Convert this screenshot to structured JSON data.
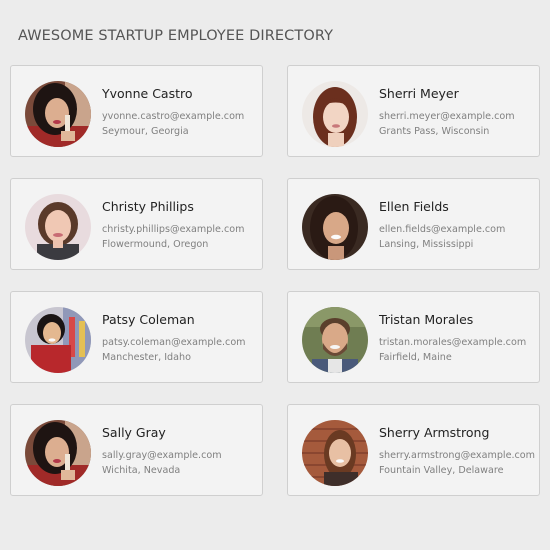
{
  "header": {
    "title": "AWESOME STARTUP EMPLOYEE DIRECTORY"
  },
  "colors": {
    "background": "#ececec",
    "card": "#f3f3f3",
    "card_border": "#cfcfcf",
    "name": "#222222",
    "meta": "#808080"
  },
  "employees": [
    {
      "name": "Yvonne Castro",
      "email": "yvonne.castro@example.com",
      "location": "Seymour, Georgia",
      "avatar_icon": "woman-portrait-icon"
    },
    {
      "name": "Sherri Meyer",
      "email": "sherri.meyer@example.com",
      "location": "Grants Pass, Wisconsin",
      "avatar_icon": "woman-portrait-icon"
    },
    {
      "name": "Christy Phillips",
      "email": "christy.phillips@example.com",
      "location": "Flowermound, Oregon",
      "avatar_icon": "woman-portrait-icon"
    },
    {
      "name": "Ellen Fields",
      "email": "ellen.fields@example.com",
      "location": "Lansing, Mississippi",
      "avatar_icon": "woman-portrait-icon"
    },
    {
      "name": "Patsy Coleman",
      "email": "patsy.coleman@example.com",
      "location": "Manchester, Idaho",
      "avatar_icon": "woman-portrait-icon"
    },
    {
      "name": "Tristan Morales",
      "email": "tristan.morales@example.com",
      "location": "Fairfield, Maine",
      "avatar_icon": "man-portrait-icon"
    },
    {
      "name": "Sally Gray",
      "email": "sally.gray@example.com",
      "location": "Wichita, Nevada",
      "avatar_icon": "woman-portrait-icon"
    },
    {
      "name": "Sherry Armstrong",
      "email": "sherry.armstrong@example.com",
      "location": "Fountain Valley, Delaware",
      "avatar_icon": "woman-portrait-icon"
    }
  ]
}
